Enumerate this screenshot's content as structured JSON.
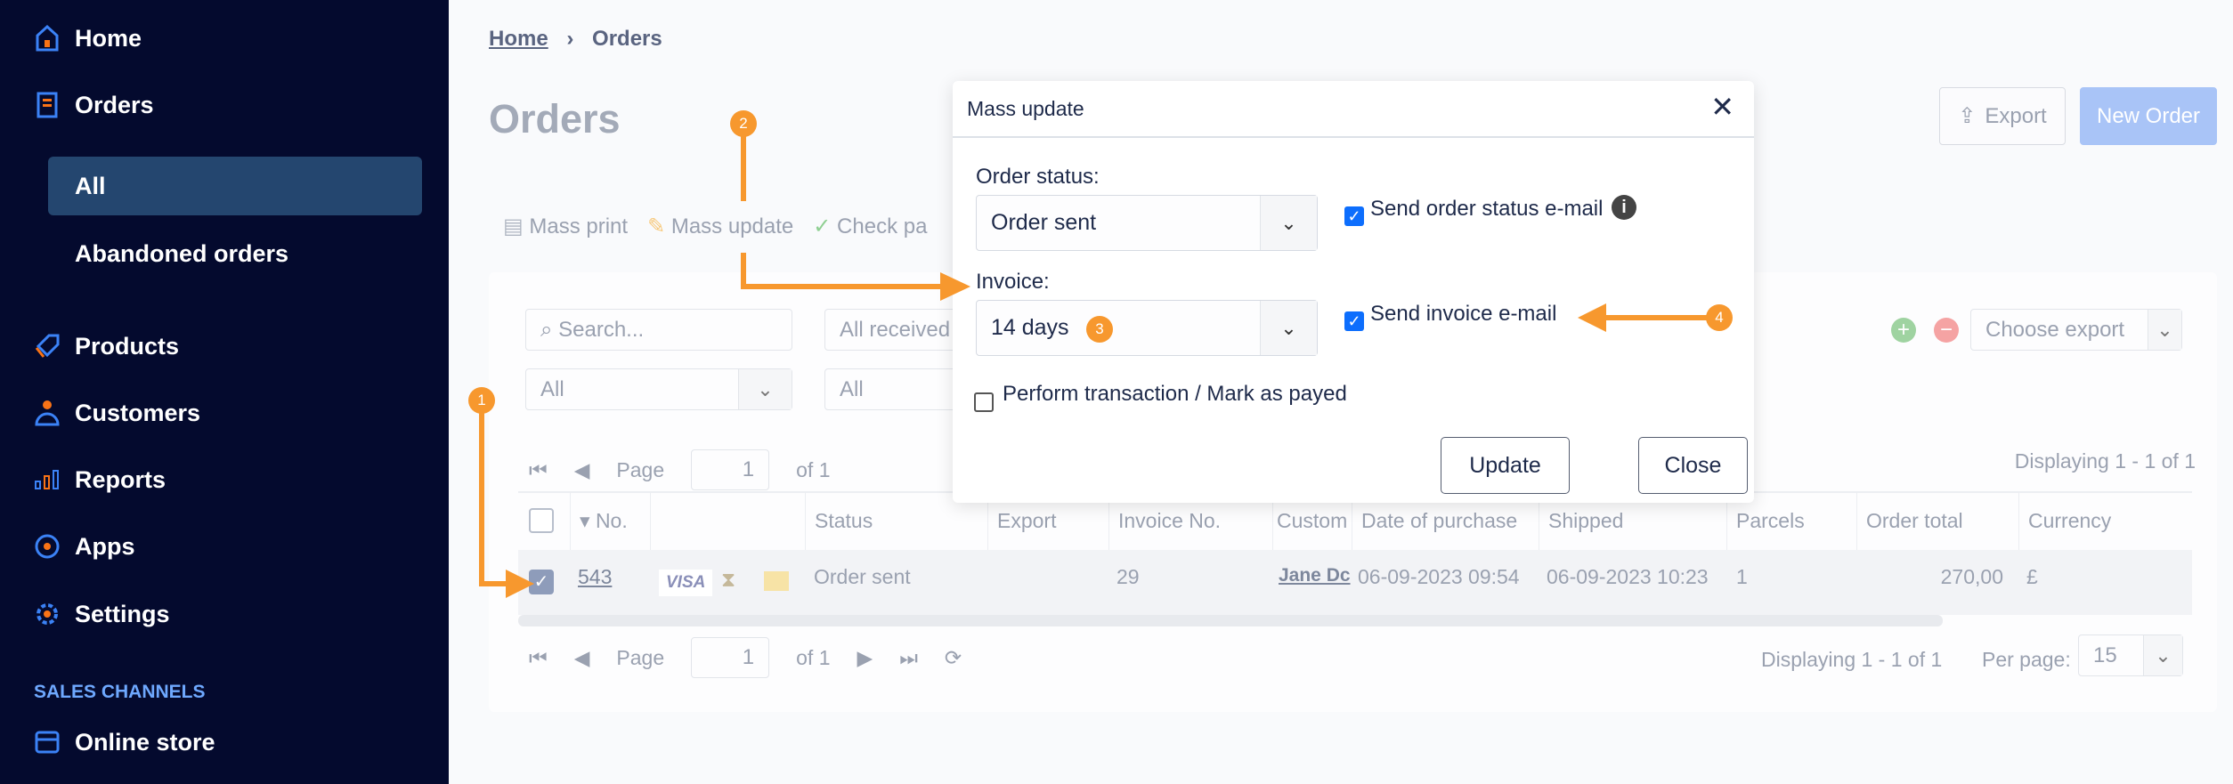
{
  "sidebar": {
    "items": [
      {
        "label": "Home",
        "icon": "home-icon"
      },
      {
        "label": "Orders",
        "icon": "orders-icon"
      },
      {
        "label": "Products",
        "icon": "tag-icon"
      },
      {
        "label": "Customers",
        "icon": "user-icon"
      },
      {
        "label": "Reports",
        "icon": "chart-icon"
      },
      {
        "label": "Apps",
        "icon": "apps-icon"
      },
      {
        "label": "Settings",
        "icon": "gear-icon"
      }
    ],
    "sub_items": [
      {
        "label": "All"
      },
      {
        "label": "Abandoned orders"
      }
    ],
    "section": "SALES CHANNELS",
    "channels": [
      {
        "label": "Online store",
        "icon": "store-icon"
      }
    ]
  },
  "breadcrumb": {
    "home": "Home",
    "current": "Orders"
  },
  "page_title": "Orders",
  "header_buttons": {
    "export": "Export",
    "new_order": "New Order"
  },
  "toolbar": {
    "mass_print": "Mass print",
    "mass_update": "Mass update",
    "check": "Check pa"
  },
  "filters": {
    "search_placeholder": "Search...",
    "received": "All received",
    "all1": "All",
    "all2": "All",
    "choose_export": "Choose export"
  },
  "pager": {
    "page": "Page",
    "value": "1",
    "of": "of 1",
    "displaying": "Displaying 1 - 1 of 1",
    "per_page": "Per page:",
    "per_page_value": "15"
  },
  "table": {
    "columns": [
      "No.",
      "",
      "Status",
      "Export",
      "Invoice No.",
      "Custom",
      "Date of purchase",
      "Shipped",
      "Parcels",
      "Order total",
      "Currency"
    ],
    "rows": [
      {
        "no": "543",
        "status": "Order sent",
        "export": "",
        "invoice": "29",
        "customer": "Jane Dc",
        "date": "06-09-2023 09:54",
        "shipped": "06-09-2023 10:23",
        "parcels": "1",
        "total": "270,00",
        "currency": "£"
      }
    ]
  },
  "modal": {
    "title": "Mass update",
    "order_status_label": "Order status:",
    "order_status_value": "Order sent",
    "send_status_email": "Send order status e-mail",
    "send_status_checked": true,
    "invoice_label": "Invoice:",
    "invoice_value": "14 days",
    "send_invoice_email": "Send invoice e-mail",
    "send_invoice_checked": true,
    "perform_transaction": "Perform transaction / Mark as payed",
    "perform_checked": false,
    "update": "Update",
    "close": "Close"
  },
  "annotations": [
    "1",
    "2",
    "3",
    "4"
  ],
  "colors": {
    "sidebar": "#040a2e",
    "accent": "#f7982e",
    "selected": "#24466f",
    "primary": "#0d6efd"
  }
}
